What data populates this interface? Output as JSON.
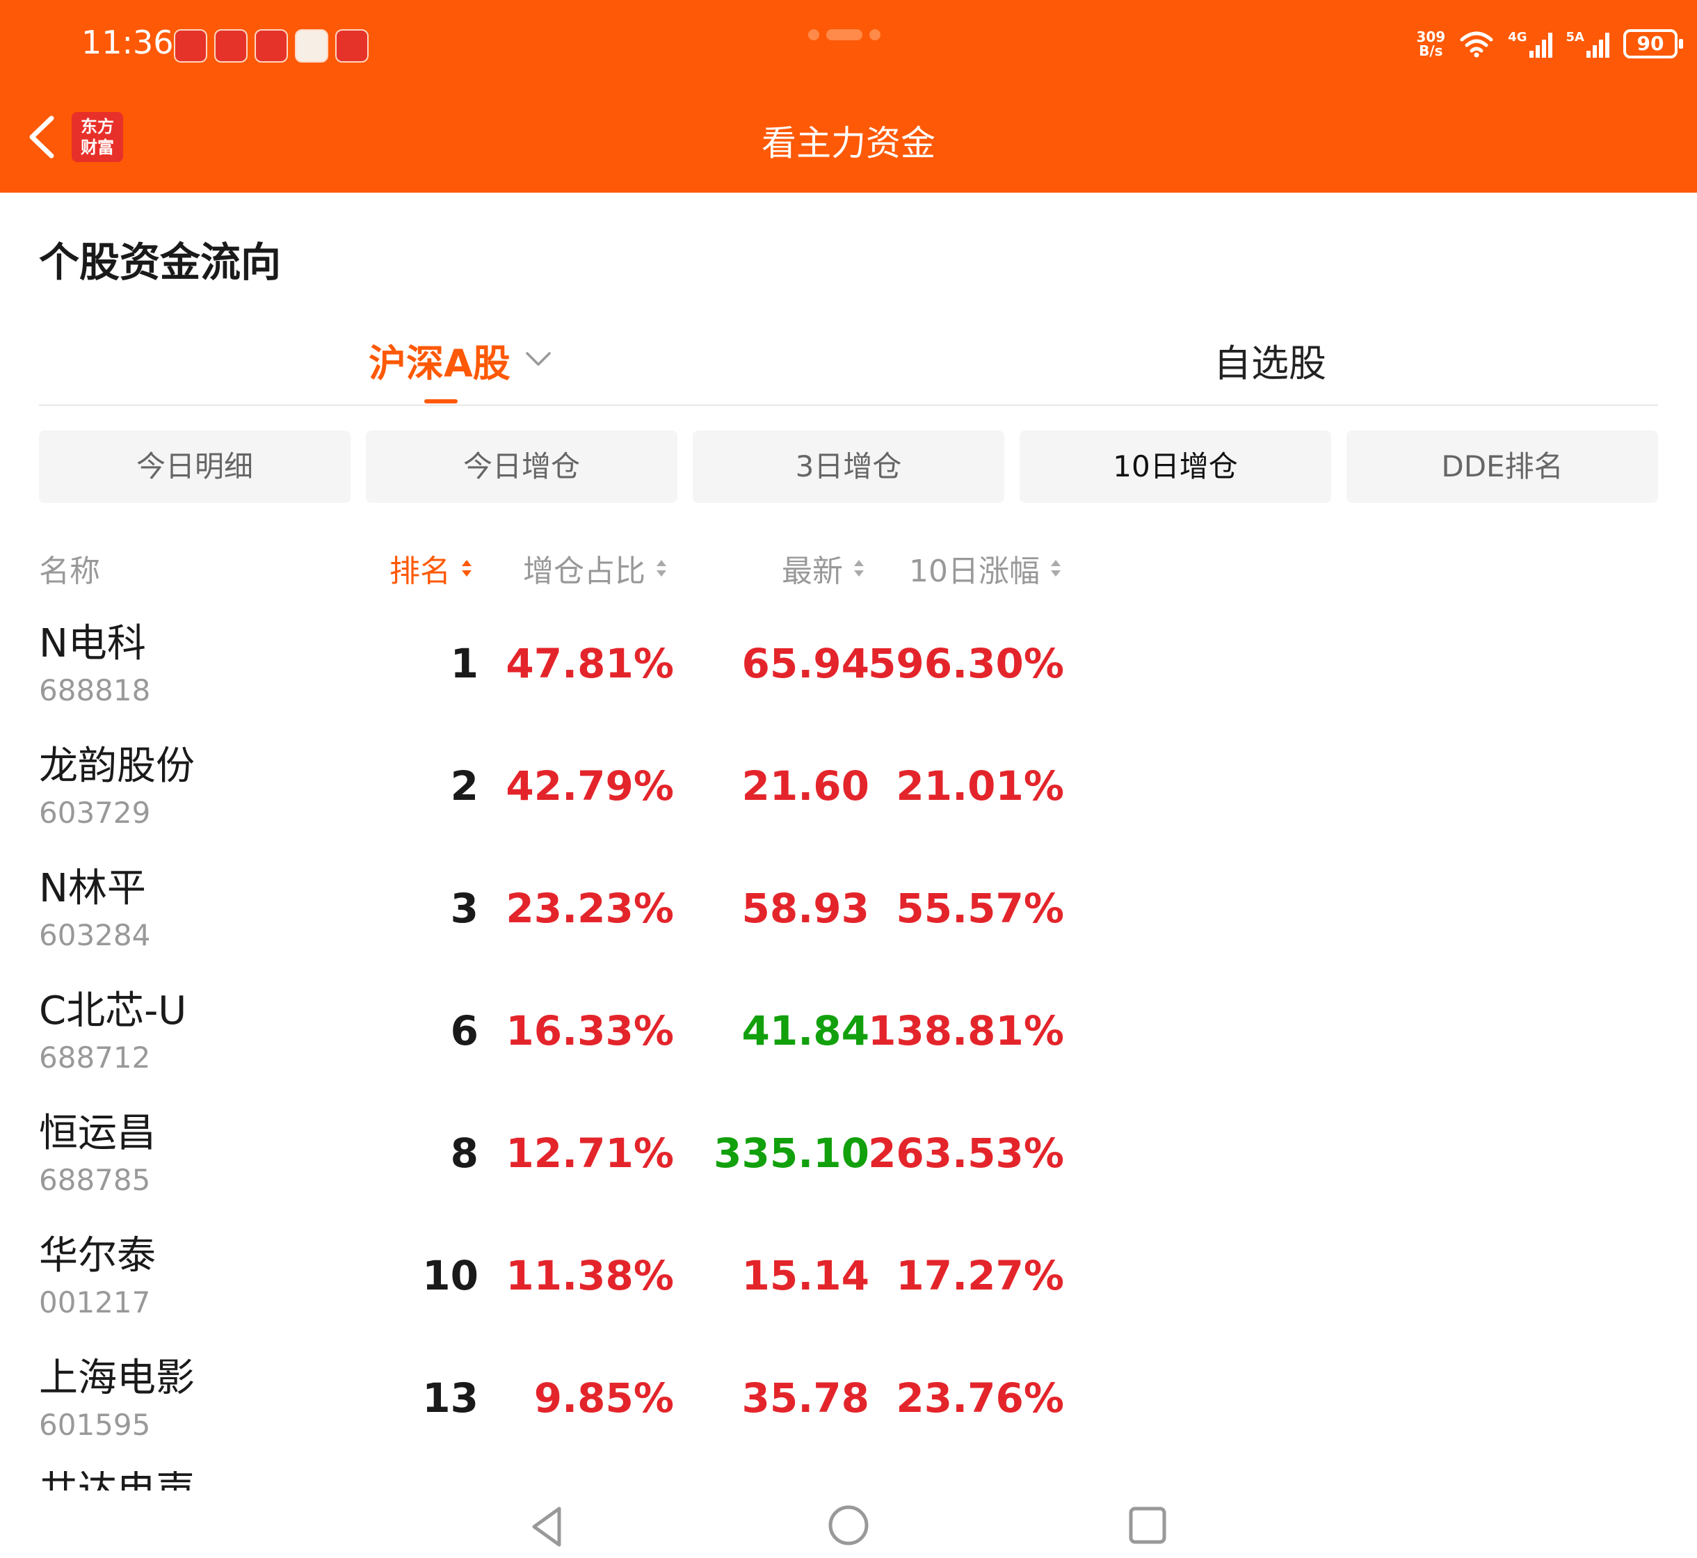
{
  "status_bar": {
    "time": "11:36",
    "net_speed_value": "309",
    "net_speed_unit": "B/s",
    "signal_1": "4G",
    "signal_2": "5A",
    "battery": "90"
  },
  "header": {
    "title": "看主力资金",
    "logo_line1": "东方",
    "logo_line2": "财富"
  },
  "section_title": "个股资金流向",
  "tabs": [
    {
      "label": "沪深A股",
      "active": true
    },
    {
      "label": "自选股",
      "active": false
    }
  ],
  "filters": [
    {
      "label": "今日明细",
      "active": false
    },
    {
      "label": "今日增仓",
      "active": false
    },
    {
      "label": "3日增仓",
      "active": false
    },
    {
      "label": "10日增仓",
      "active": true
    },
    {
      "label": "DDE排名",
      "active": false
    }
  ],
  "columns": {
    "name": "名称",
    "rank": "排名",
    "ratio": "增仓占比",
    "price": "最新",
    "change": "10日涨幅"
  },
  "rows": [
    {
      "name": "N电科",
      "code": "688818",
      "rank": "1",
      "ratio": "47.81%",
      "price": "65.94",
      "price_color": "red",
      "change": "596.30%"
    },
    {
      "name": "龙韵股份",
      "code": "603729",
      "rank": "2",
      "ratio": "42.79%",
      "price": "21.60",
      "price_color": "red",
      "change": "21.01%"
    },
    {
      "name": "N林平",
      "code": "603284",
      "rank": "3",
      "ratio": "23.23%",
      "price": "58.93",
      "price_color": "red",
      "change": "55.57%"
    },
    {
      "name": "C北芯-U",
      "code": "688712",
      "rank": "6",
      "ratio": "16.33%",
      "price": "41.84",
      "price_color": "green",
      "change": "138.81%"
    },
    {
      "name": "恒运昌",
      "code": "688785",
      "rank": "8",
      "ratio": "12.71%",
      "price": "335.10",
      "price_color": "green",
      "change": "263.53%"
    },
    {
      "name": "华尔泰",
      "code": "001217",
      "rank": "10",
      "ratio": "11.38%",
      "price": "15.14",
      "price_color": "red",
      "change": "17.27%"
    },
    {
      "name": "上海电影",
      "code": "601595",
      "rank": "13",
      "ratio": "9.85%",
      "price": "35.78",
      "price_color": "red",
      "change": "23.76%"
    }
  ],
  "partial_row_name": "共达电声",
  "colors": {
    "brand": "#fe5906",
    "up": "#e3252b",
    "down": "#12a00c"
  }
}
